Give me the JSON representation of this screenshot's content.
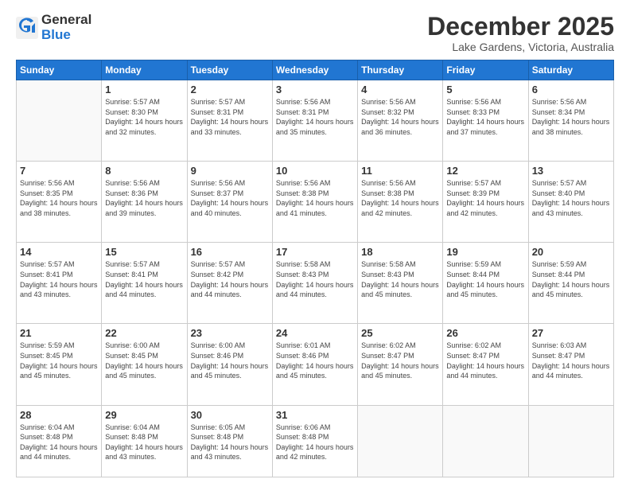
{
  "logo": {
    "general": "General",
    "blue": "Blue"
  },
  "header": {
    "month": "December 2025",
    "location": "Lake Gardens, Victoria, Australia"
  },
  "weekdays": [
    "Sunday",
    "Monday",
    "Tuesday",
    "Wednesday",
    "Thursday",
    "Friday",
    "Saturday"
  ],
  "weeks": [
    [
      {
        "day": "",
        "sunrise": "",
        "sunset": "",
        "daylight": ""
      },
      {
        "day": "1",
        "sunrise": "Sunrise: 5:57 AM",
        "sunset": "Sunset: 8:30 PM",
        "daylight": "Daylight: 14 hours and 32 minutes."
      },
      {
        "day": "2",
        "sunrise": "Sunrise: 5:57 AM",
        "sunset": "Sunset: 8:31 PM",
        "daylight": "Daylight: 14 hours and 33 minutes."
      },
      {
        "day": "3",
        "sunrise": "Sunrise: 5:56 AM",
        "sunset": "Sunset: 8:31 PM",
        "daylight": "Daylight: 14 hours and 35 minutes."
      },
      {
        "day": "4",
        "sunrise": "Sunrise: 5:56 AM",
        "sunset": "Sunset: 8:32 PM",
        "daylight": "Daylight: 14 hours and 36 minutes."
      },
      {
        "day": "5",
        "sunrise": "Sunrise: 5:56 AM",
        "sunset": "Sunset: 8:33 PM",
        "daylight": "Daylight: 14 hours and 37 minutes."
      },
      {
        "day": "6",
        "sunrise": "Sunrise: 5:56 AM",
        "sunset": "Sunset: 8:34 PM",
        "daylight": "Daylight: 14 hours and 38 minutes."
      }
    ],
    [
      {
        "day": "7",
        "sunrise": "Sunrise: 5:56 AM",
        "sunset": "Sunset: 8:35 PM",
        "daylight": "Daylight: 14 hours and 38 minutes."
      },
      {
        "day": "8",
        "sunrise": "Sunrise: 5:56 AM",
        "sunset": "Sunset: 8:36 PM",
        "daylight": "Daylight: 14 hours and 39 minutes."
      },
      {
        "day": "9",
        "sunrise": "Sunrise: 5:56 AM",
        "sunset": "Sunset: 8:37 PM",
        "daylight": "Daylight: 14 hours and 40 minutes."
      },
      {
        "day": "10",
        "sunrise": "Sunrise: 5:56 AM",
        "sunset": "Sunset: 8:38 PM",
        "daylight": "Daylight: 14 hours and 41 minutes."
      },
      {
        "day": "11",
        "sunrise": "Sunrise: 5:56 AM",
        "sunset": "Sunset: 8:38 PM",
        "daylight": "Daylight: 14 hours and 42 minutes."
      },
      {
        "day": "12",
        "sunrise": "Sunrise: 5:57 AM",
        "sunset": "Sunset: 8:39 PM",
        "daylight": "Daylight: 14 hours and 42 minutes."
      },
      {
        "day": "13",
        "sunrise": "Sunrise: 5:57 AM",
        "sunset": "Sunset: 8:40 PM",
        "daylight": "Daylight: 14 hours and 43 minutes."
      }
    ],
    [
      {
        "day": "14",
        "sunrise": "Sunrise: 5:57 AM",
        "sunset": "Sunset: 8:41 PM",
        "daylight": "Daylight: 14 hours and 43 minutes."
      },
      {
        "day": "15",
        "sunrise": "Sunrise: 5:57 AM",
        "sunset": "Sunset: 8:41 PM",
        "daylight": "Daylight: 14 hours and 44 minutes."
      },
      {
        "day": "16",
        "sunrise": "Sunrise: 5:57 AM",
        "sunset": "Sunset: 8:42 PM",
        "daylight": "Daylight: 14 hours and 44 minutes."
      },
      {
        "day": "17",
        "sunrise": "Sunrise: 5:58 AM",
        "sunset": "Sunset: 8:43 PM",
        "daylight": "Daylight: 14 hours and 44 minutes."
      },
      {
        "day": "18",
        "sunrise": "Sunrise: 5:58 AM",
        "sunset": "Sunset: 8:43 PM",
        "daylight": "Daylight: 14 hours and 45 minutes."
      },
      {
        "day": "19",
        "sunrise": "Sunrise: 5:59 AM",
        "sunset": "Sunset: 8:44 PM",
        "daylight": "Daylight: 14 hours and 45 minutes."
      },
      {
        "day": "20",
        "sunrise": "Sunrise: 5:59 AM",
        "sunset": "Sunset: 8:44 PM",
        "daylight": "Daylight: 14 hours and 45 minutes."
      }
    ],
    [
      {
        "day": "21",
        "sunrise": "Sunrise: 5:59 AM",
        "sunset": "Sunset: 8:45 PM",
        "daylight": "Daylight: 14 hours and 45 minutes."
      },
      {
        "day": "22",
        "sunrise": "Sunrise: 6:00 AM",
        "sunset": "Sunset: 8:45 PM",
        "daylight": "Daylight: 14 hours and 45 minutes."
      },
      {
        "day": "23",
        "sunrise": "Sunrise: 6:00 AM",
        "sunset": "Sunset: 8:46 PM",
        "daylight": "Daylight: 14 hours and 45 minutes."
      },
      {
        "day": "24",
        "sunrise": "Sunrise: 6:01 AM",
        "sunset": "Sunset: 8:46 PM",
        "daylight": "Daylight: 14 hours and 45 minutes."
      },
      {
        "day": "25",
        "sunrise": "Sunrise: 6:02 AM",
        "sunset": "Sunset: 8:47 PM",
        "daylight": "Daylight: 14 hours and 45 minutes."
      },
      {
        "day": "26",
        "sunrise": "Sunrise: 6:02 AM",
        "sunset": "Sunset: 8:47 PM",
        "daylight": "Daylight: 14 hours and 44 minutes."
      },
      {
        "day": "27",
        "sunrise": "Sunrise: 6:03 AM",
        "sunset": "Sunset: 8:47 PM",
        "daylight": "Daylight: 14 hours and 44 minutes."
      }
    ],
    [
      {
        "day": "28",
        "sunrise": "Sunrise: 6:04 AM",
        "sunset": "Sunset: 8:48 PM",
        "daylight": "Daylight: 14 hours and 44 minutes."
      },
      {
        "day": "29",
        "sunrise": "Sunrise: 6:04 AM",
        "sunset": "Sunset: 8:48 PM",
        "daylight": "Daylight: 14 hours and 43 minutes."
      },
      {
        "day": "30",
        "sunrise": "Sunrise: 6:05 AM",
        "sunset": "Sunset: 8:48 PM",
        "daylight": "Daylight: 14 hours and 43 minutes."
      },
      {
        "day": "31",
        "sunrise": "Sunrise: 6:06 AM",
        "sunset": "Sunset: 8:48 PM",
        "daylight": "Daylight: 14 hours and 42 minutes."
      },
      {
        "day": "",
        "sunrise": "",
        "sunset": "",
        "daylight": ""
      },
      {
        "day": "",
        "sunrise": "",
        "sunset": "",
        "daylight": ""
      },
      {
        "day": "",
        "sunrise": "",
        "sunset": "",
        "daylight": ""
      }
    ]
  ]
}
